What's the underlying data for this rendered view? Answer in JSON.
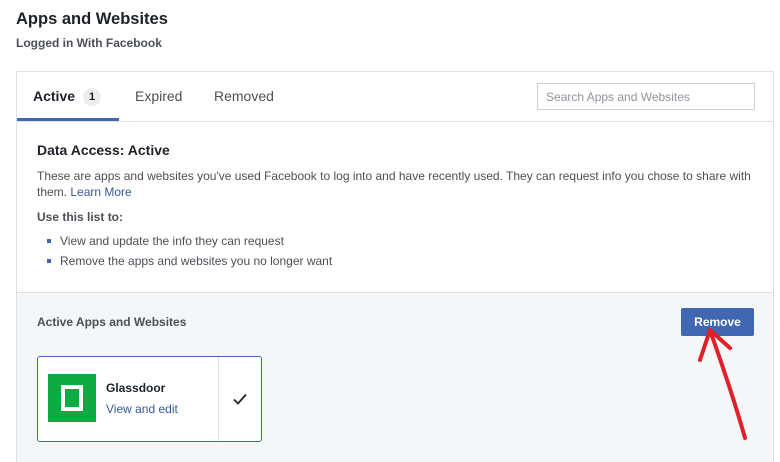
{
  "header": {
    "title": "Apps and Websites",
    "subtitle": "Logged in With Facebook"
  },
  "tabs": [
    {
      "label": "Active",
      "count": "1",
      "selected": true
    },
    {
      "label": "Expired",
      "selected": false
    },
    {
      "label": "Removed",
      "selected": false
    }
  ],
  "search": {
    "placeholder": "Search Apps and Websites",
    "value": ""
  },
  "info": {
    "title": "Data Access: Active",
    "description": "These are apps and websites you've used Facebook to log into and have recently used. They can request info you chose to share with them.",
    "learn_more": "Learn More",
    "use_label": "Use this list to:",
    "bullets": [
      "View and update the info they can request",
      "Remove the apps and websites you no longer want"
    ]
  },
  "apps_section": {
    "heading": "Active Apps and Websites",
    "remove_label": "Remove",
    "apps": [
      {
        "name": "Glassdoor",
        "link_label": "View and edit",
        "checked": true,
        "logo_color": "#0caa41"
      }
    ]
  },
  "colors": {
    "accent": "#4267b2",
    "link": "#365899",
    "annotation": "#e0202a"
  },
  "icons": {
    "app_logo": "glassdoor-logo-icon",
    "check": "checkmark-icon",
    "annotation": "red-arrow-icon"
  }
}
